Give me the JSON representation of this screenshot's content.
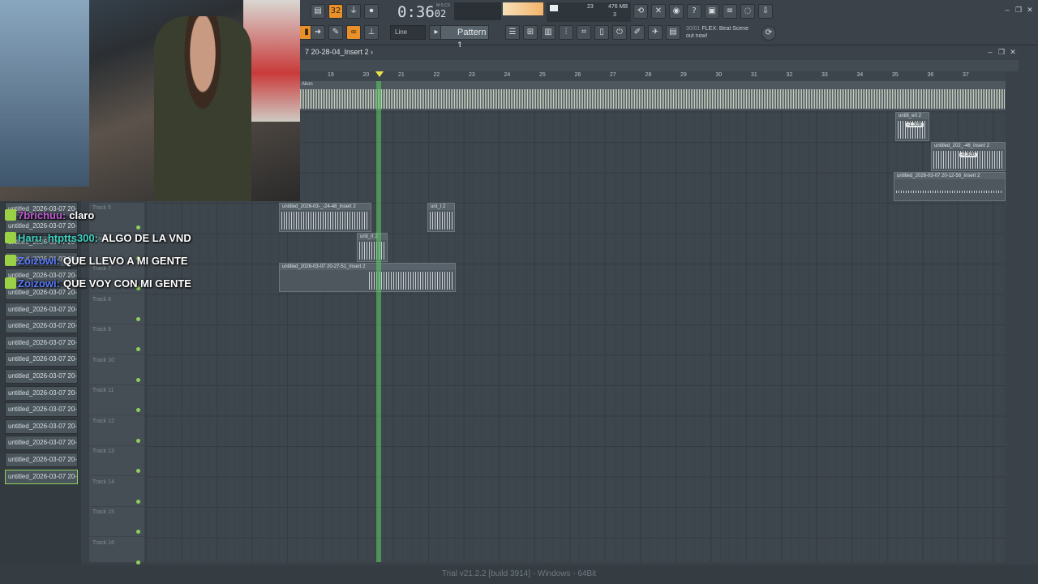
{
  "toolbar": {
    "time": "0:36",
    "time_frac": "02",
    "time_unit_label": "M:S:CS",
    "snap_label": "Line",
    "pattern_label": "Pattern 1",
    "cpu_value": "23",
    "memory_value": "476 MB",
    "voices_value": "3",
    "news_count": "30/01",
    "news_title": "FLEX: Beat Scene",
    "news_subtitle": "out now!",
    "accent_color": "#e8902a"
  },
  "playlist": {
    "title": "7 20-28-04_Insert 2 ›",
    "ticks": [
      "19",
      "20",
      "21",
      "22",
      "23",
      "24",
      "25",
      "26",
      "27",
      "28",
      "29",
      "30",
      "31",
      "32",
      "33",
      "34",
      "35",
      "36",
      "37"
    ],
    "master_label": "Akon",
    "playhead_color": "#5ad15f"
  },
  "clips": [
    {
      "title": "untitl_ert 2",
      "db": "-1.3dB"
    },
    {
      "title": "untitled_202_-46_Insert 2",
      "db": "-0.9dB"
    },
    {
      "title": "untitled_2026-03-07 20-12-58_Insert 2"
    },
    {
      "title": "untitled_2026-03-_-24-48_Insert 2"
    },
    {
      "title": "unt_t 2"
    },
    {
      "title": "unti_rt 2"
    },
    {
      "title": "untitled_2026-03-07 20-27-51_Insert 2"
    }
  ],
  "tracks": [
    "Track 5",
    "Track 6",
    "Track 7",
    "Track 8",
    "Track 9",
    "Track 10",
    "Track 11",
    "Track 12",
    "Track 13",
    "Track 14",
    "Track 15",
    "Track 16"
  ],
  "sidebar": {
    "items": [
      "untitled_2026-03-07 20-",
      "untitled_2026-03-07 20-",
      "untitled_2026-03-07 20-",
      "untitled_2026-03-07 20-",
      "untitled_2026-03-07 20-",
      "untitled_2026-03-07 20-",
      "untitled_2026-03-07 20-",
      "untitled_2026-03-07 20-",
      "untitled_2026-03-07 20-",
      "untitled_2026-03-07 20-",
      "untitled_2026-03-07 20-",
      "untitled_2026-03-07 20-",
      "untitled_2026-03-07 20-",
      "untitled_2026-03-07 20-",
      "untitled_2026-03-07 20-",
      "untitled_2026-03-07 20-",
      "untitled_2026-03-07 20-"
    ]
  },
  "chat": [
    {
      "user": "7brichuu:",
      "user_color": "#c15bd1",
      "message": "claro"
    },
    {
      "user": "Haru_htptts300:",
      "user_color": "#3fd2c2",
      "message": "ALGO DE LA VND"
    },
    {
      "user": "Zoizowi:",
      "user_color": "#5a7cff",
      "message": "QUE LLEVO A MI GENTE"
    },
    {
      "user": "Zoizowi:",
      "user_color": "#5a7cff",
      "message": "QUE VOY CON MI GENTE"
    }
  ],
  "status": "Trial v21.2.2 [build 3914] - Windows - 64Bit"
}
